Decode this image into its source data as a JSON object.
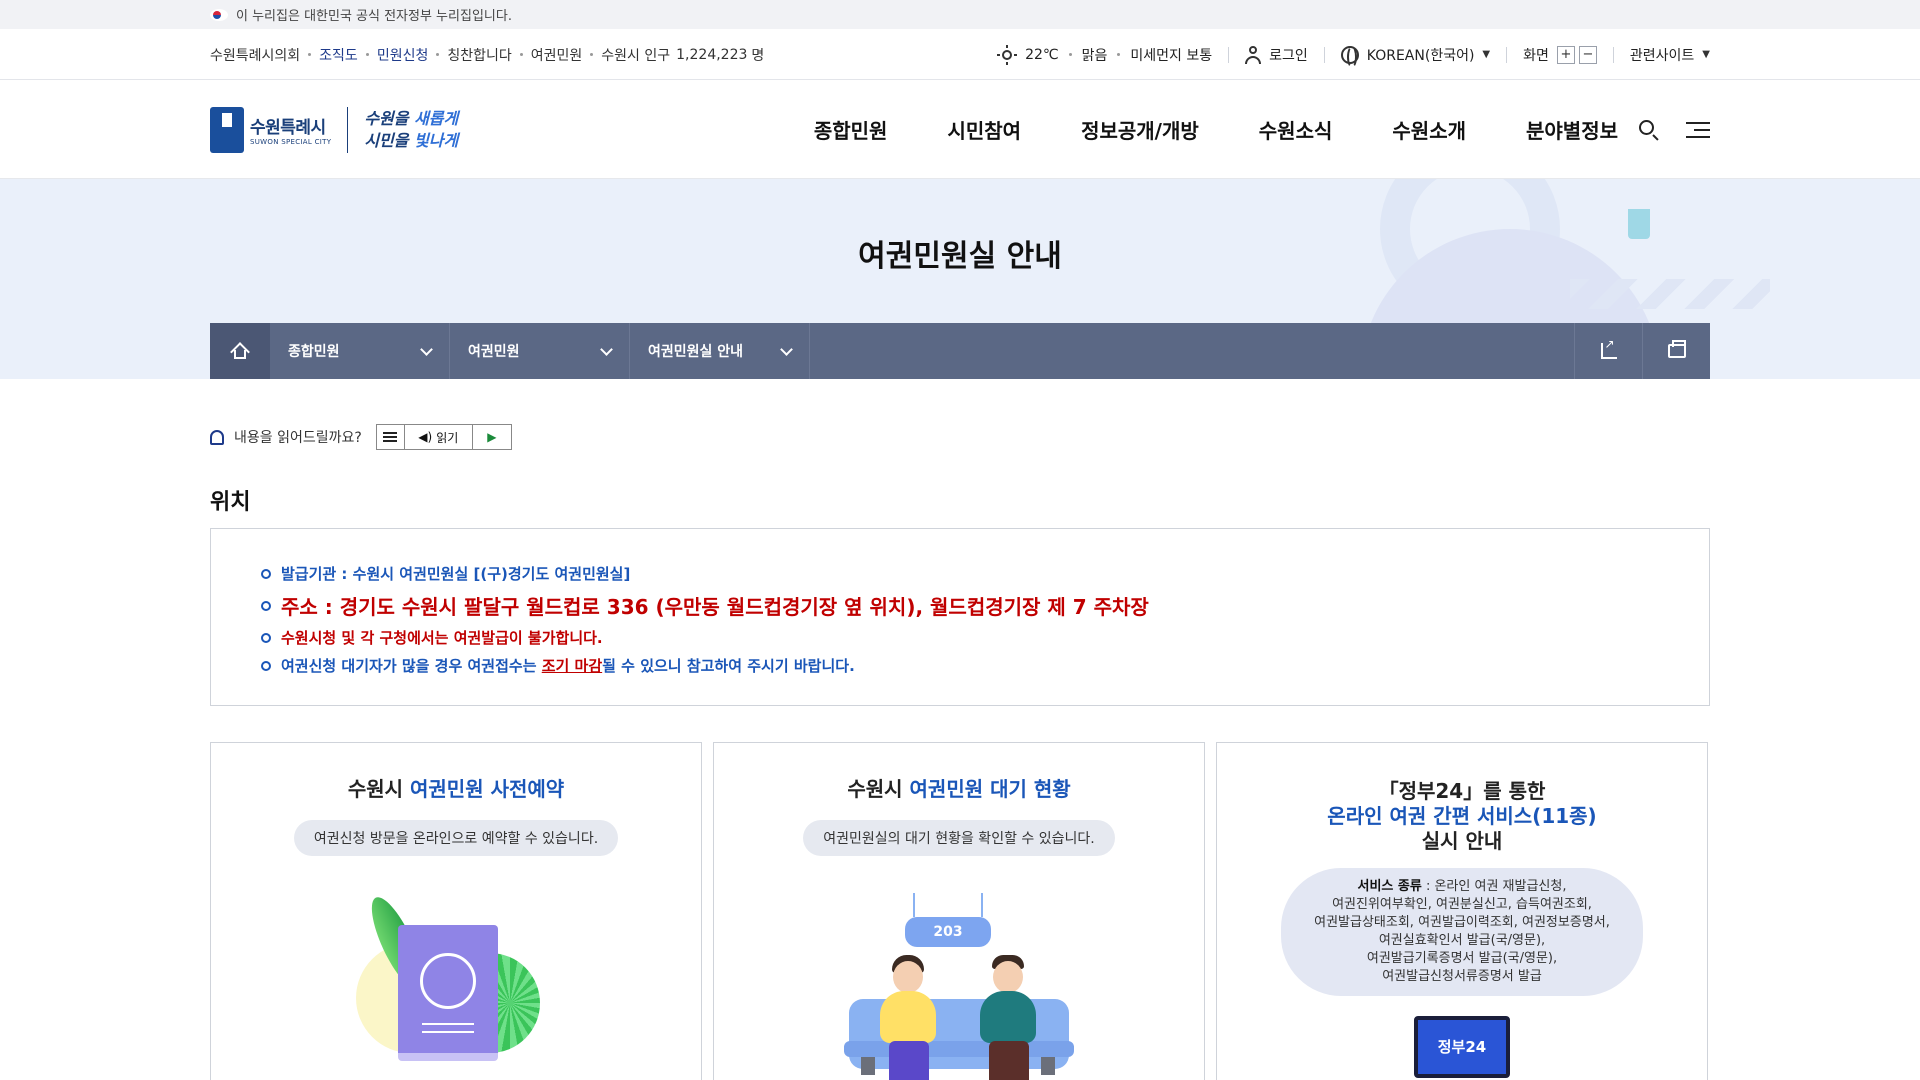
{
  "gov_banner": {
    "text": "이 누리집은 대한민국 공식 전자정부 누리집입니다."
  },
  "util": {
    "links": [
      "수원특례시의회",
      "조직도",
      "민원신청",
      "칭찬합니다",
      "여권민원"
    ],
    "population_label": "수원시 인구",
    "population_value": "1,224,223",
    "population_unit": "명",
    "temp": "22℃",
    "weather": "맑음",
    "dust": "미세먼지 보통",
    "login": "로그인",
    "language": "KOREAN(한국어)",
    "screen_label": "화면",
    "zoom_in": "+",
    "zoom_out": "−",
    "related": "관련사이트"
  },
  "logo": {
    "kor": "수원특례시",
    "eng": "SUWON SPECIAL CITY",
    "slogan_line1_a": "수원을 ",
    "slogan_line1_b": "새롭게",
    "slogan_line2_a": "시민을 ",
    "slogan_line2_b": "빛나게"
  },
  "gnb": [
    "종합민원",
    "시민참여",
    "정보공개/개방",
    "수원소식",
    "수원소개",
    "분야별정보"
  ],
  "page_title": "여권민원실 안내",
  "breadcrumb": [
    "종합민원",
    "여권민원",
    "여권민원실 안내"
  ],
  "reader": {
    "prompt": "내용을 읽어드릴까요?",
    "read_label": "읽기"
  },
  "section_title": "위치",
  "location": {
    "line1": "발급기관 : 수원시 여권민원실 [(구)경기도 여권민원실]",
    "line2": "주소 : 경기도 수원시 팔달구 월드컵로 336 (우만동 월드컵경기장 옆 위치),  월드컵경기장 제 7 주차장",
    "line3": "수원시청 및 각 구청에서는 여권발급이 불가합니다.",
    "line4_a": "여권신청 대기자가 많을 경우 여권접수는 ",
    "line4_b": "조기 마감",
    "line4_c": "될 수 있으니 참고하여 주시기 바랍니다."
  },
  "cards": [
    {
      "title_a": "수원시 ",
      "title_b": "여권민원 사전예약",
      "desc": "여권신청 방문을 온라인으로 예약할 수 있습니다."
    },
    {
      "title_a": "수원시 ",
      "title_b": "여권민원 대기 현황",
      "desc": "여권민원실의 대기 현황을 확인할 수 있습니다.",
      "board_number": "203"
    },
    {
      "title_line1": "「정부24」를 통한",
      "title_line2": "온라인 여권 간편 서비스(11종)",
      "title_line3": "실시 안내",
      "svc_label": "서비스 종류",
      "svc_text": " : 온라인 여권 재발급신청,",
      "svc_lines": [
        "여권진위여부확인, 여권분실신고, 습득여권조회,",
        "여권발급상태조회, 여권발급이력조회, 여권정보증명서,",
        "여권실효확인서 발급(국/영문),",
        "여권발급기록증명서 발급(국/영문),",
        "여권발급신청서류증명서 발급"
      ],
      "monitor_label": "정부24"
    }
  ],
  "colors": {
    "accent_blue": "#1a56b8",
    "alert_red": "#c00000",
    "location_bar": "#5b6885"
  }
}
